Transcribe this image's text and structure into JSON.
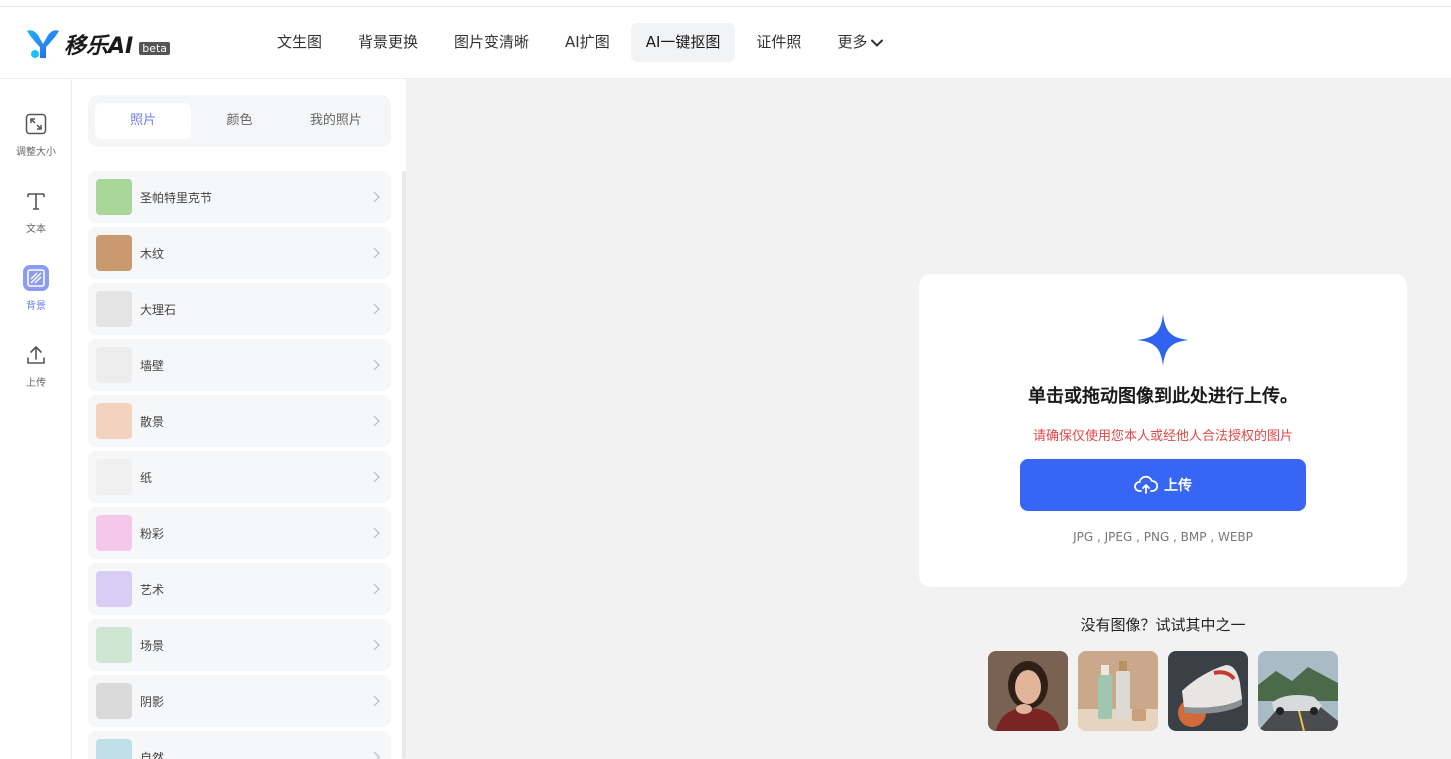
{
  "brand": {
    "name": "移乐AI",
    "badge": "beta",
    "accent": "#3766f4"
  },
  "nav": {
    "items": [
      {
        "label": "文生图"
      },
      {
        "label": "背景更换"
      },
      {
        "label": "图片变清晰"
      },
      {
        "label": "AI扩图"
      },
      {
        "label": "AI一键抠图",
        "active": true
      },
      {
        "label": "证件照"
      }
    ],
    "more_label": "更多"
  },
  "rail": {
    "items": [
      {
        "label": "调整大小",
        "icon": "resize-icon"
      },
      {
        "label": "文本",
        "icon": "text-icon"
      },
      {
        "label": "背景",
        "icon": "background-icon",
        "active": true
      },
      {
        "label": "上传",
        "icon": "upload-icon"
      }
    ]
  },
  "panel": {
    "tabs": [
      {
        "label": "照片",
        "active": true
      },
      {
        "label": "颜色"
      },
      {
        "label": "我的照片"
      }
    ],
    "categories": [
      {
        "label": "圣帕特里克节",
        "color": "#a9d79a"
      },
      {
        "label": "木纹",
        "color": "#c99a6d"
      },
      {
        "label": "大理石",
        "color": "#e4e4e4"
      },
      {
        "label": "墙壁",
        "color": "#ededed"
      },
      {
        "label": "散景",
        "color": "#f3d2c0"
      },
      {
        "label": "纸",
        "color": "#f0f0f0"
      },
      {
        "label": "粉彩",
        "color": "#f4c8e8"
      },
      {
        "label": "艺术",
        "color": "#d7cdf5"
      },
      {
        "label": "场景",
        "color": "#cfe6d2"
      },
      {
        "label": "阴影",
        "color": "#dadada"
      },
      {
        "label": "自然",
        "color": "#bfe0e8"
      }
    ]
  },
  "upload": {
    "title": "单击或拖动图像到此处进行上传。",
    "warning": "请确保仅使用您本人或经他人合法授权的图片",
    "button_label": "上传",
    "formats": "JPG , JPEG , PNG , BMP , WEBP"
  },
  "samples": {
    "title": "没有图像？试试其中之一",
    "items": [
      {
        "name": "sample-portrait"
      },
      {
        "name": "sample-bottles"
      },
      {
        "name": "sample-sneaker"
      },
      {
        "name": "sample-car"
      }
    ]
  }
}
